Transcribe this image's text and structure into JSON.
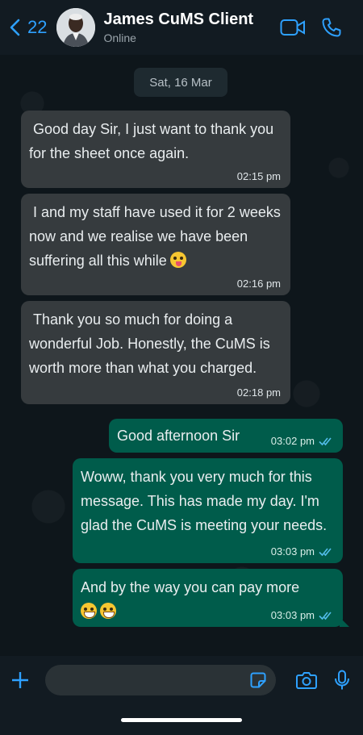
{
  "header": {
    "back_count": "22",
    "contact_name": "James CuMS Client",
    "status": "Online",
    "icons": [
      "chevron-left-icon",
      "video-call-icon",
      "phone-icon"
    ]
  },
  "chat": {
    "date_separator": "Sat, 16 Mar",
    "messages": [
      {
        "direction": "incoming",
        "text": " Good day Sir, I just want to thank you for the sheet once again.",
        "time": "02:15 pm"
      },
      {
        "direction": "incoming",
        "text": " I and my staff have used it for 2 weeks now and we realise we have been suffering all this while",
        "emoji": "zany-face",
        "time": "02:16 pm"
      },
      {
        "direction": "incoming",
        "text": " Thank you so much for doing a wonderful Job. Honestly, the CuMS is worth more than what you charged.",
        "time": "02:18 pm"
      },
      {
        "direction": "outgoing",
        "text": "Good afternoon Sir",
        "time": "03:02 pm",
        "status": "read"
      },
      {
        "direction": "outgoing",
        "text": "Woww, thank you very much for this message. This has made my day. I'm glad the CuMS is meeting your needs.",
        "time": "03:03 pm",
        "status": "read"
      },
      {
        "direction": "outgoing",
        "text": "And by the way you can pay more",
        "emoji": "grinning-face x2",
        "time": "03:03 pm",
        "status": "read"
      }
    ]
  },
  "composer": {
    "value": "",
    "icons": [
      "plus-icon",
      "sticker-icon",
      "camera-icon",
      "microphone-icon"
    ]
  },
  "colors": {
    "accent": "#2ea1ff",
    "incoming_bubble": "#363b3e",
    "outgoing_bubble": "#005c4b",
    "read_ticks": "#53bdeb"
  }
}
